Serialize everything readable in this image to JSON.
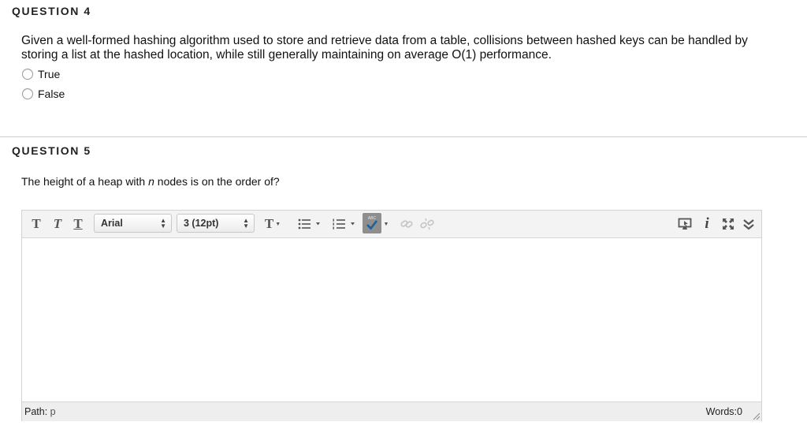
{
  "question4": {
    "heading": "QUESTION 4",
    "text": "Given a well-formed hashing algorithm used to store and retrieve data from a table, collisions between hashed keys can be handled by storing a list at the hashed location, while still generally maintaining on average O(1) performance.",
    "options": [
      "True",
      "False"
    ]
  },
  "question5": {
    "heading": "QUESTION 5",
    "text_before": "The height of a heap with ",
    "text_var": "n",
    "text_after": " nodes is on the order of?"
  },
  "editor": {
    "font_family": "Arial",
    "font_size": "3 (12pt)",
    "path_label": "Path:",
    "path_value": "p",
    "words_label": "Words:0",
    "spellcheck_badge": "ABC",
    "toolbar_icons": [
      "bold-icon",
      "italic-icon",
      "underline-icon",
      "text-color-icon",
      "bullet-list-icon",
      "numbered-list-icon",
      "spellcheck-icon",
      "link-icon",
      "unlink-icon",
      "preview-icon",
      "info-icon",
      "fullscreen-icon",
      "collapse-icon"
    ]
  }
}
